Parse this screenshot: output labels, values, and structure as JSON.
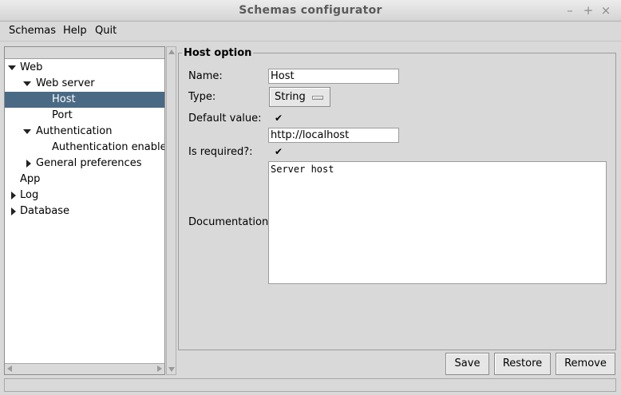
{
  "window": {
    "title": "Schemas configurator",
    "controls": {
      "minimize": "–",
      "maximize": "+",
      "close": "×"
    }
  },
  "menu": [
    "Schemas",
    "Help",
    "Quit"
  ],
  "tree": {
    "items": [
      {
        "label": "Web",
        "toggle": "expanded"
      },
      {
        "label": "Web server",
        "toggle": "expanded"
      },
      {
        "label": "Host",
        "toggle": "none",
        "selected": true
      },
      {
        "label": "Port",
        "toggle": "none"
      },
      {
        "label": "Authentication",
        "toggle": "expanded"
      },
      {
        "label": "Authentication enabled",
        "toggle": "none"
      },
      {
        "label": "General preferences",
        "toggle": "collapsed"
      },
      {
        "label": "App",
        "toggle": "none"
      },
      {
        "label": "Log",
        "toggle": "collapsed"
      },
      {
        "label": "Database",
        "toggle": "collapsed"
      }
    ]
  },
  "option": {
    "group_title": "Host option",
    "name_label": "Name:",
    "name_value": "Host",
    "type_label": "Type:",
    "type_value": "String",
    "default_label": "Default value:",
    "default_checked": true,
    "default_value": "http://localhost",
    "required_label": "Is required?:",
    "required_checked": true,
    "doc_label": "Documentation:",
    "doc_value": "Server host"
  },
  "buttons": {
    "save": "Save",
    "restore": "Restore",
    "remove": "Remove"
  },
  "colors": {
    "selection": "#4a6984",
    "background": "#d9d9d9"
  },
  "icons": {
    "check": "✔"
  }
}
